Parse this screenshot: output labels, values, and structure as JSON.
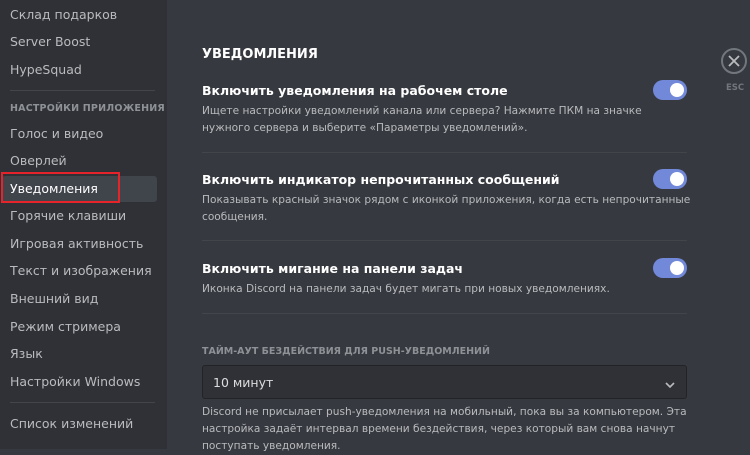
{
  "sidebar": {
    "items_top": [
      "Склад подарков",
      "Server Boost",
      "HypeSquad"
    ],
    "header": "НАСТРОЙКИ ПРИЛОЖЕНИЯ",
    "items": [
      "Голос и видео",
      "Оверлей",
      "Уведомления",
      "Горячие клавиши",
      "Игровая активность",
      "Текст и изображения",
      "Внешний вид",
      "Режим стримера",
      "Язык",
      "Настройки Windows"
    ],
    "bottom": "Список изменений",
    "selected": "Уведомления"
  },
  "main": {
    "title": "УВЕДОМЛЕНИЯ",
    "options": [
      {
        "title": "Включить уведомления на рабочем столе",
        "desc": "Ищете настройки уведомлений канала или сервера? Нажмите ПКМ на значке нужного сервера и выберите «Параметры уведомлений».",
        "enabled": true
      },
      {
        "title": "Включить индикатор непрочитанных сообщений",
        "desc": "Показывать красный значок рядом с иконкой приложения, когда есть непрочитанные сообщения.",
        "enabled": true
      },
      {
        "title": "Включить мигание на панели задач",
        "desc": "Иконка Discord на панели задач будет мигать при новых уведомлениях.",
        "enabled": true
      }
    ],
    "timeout": {
      "label": "ТАЙМ-АУТ БЕЗДЕЙСТВИЯ ДЛЯ PUSH-УВЕДОМЛЕНИЙ",
      "value": "10 минут",
      "desc": "Discord не присылает push-уведомления на мобильный, пока вы за компьютером. Эта настройка задаёт интервал времени бездействия, через который вам снова начнут поступать уведомления."
    }
  },
  "close": {
    "label": "ESC"
  },
  "colors": {
    "accent": "#7289da",
    "highlight": "#e5232b",
    "background": "#36393f",
    "sidebar": "#2f3136"
  }
}
